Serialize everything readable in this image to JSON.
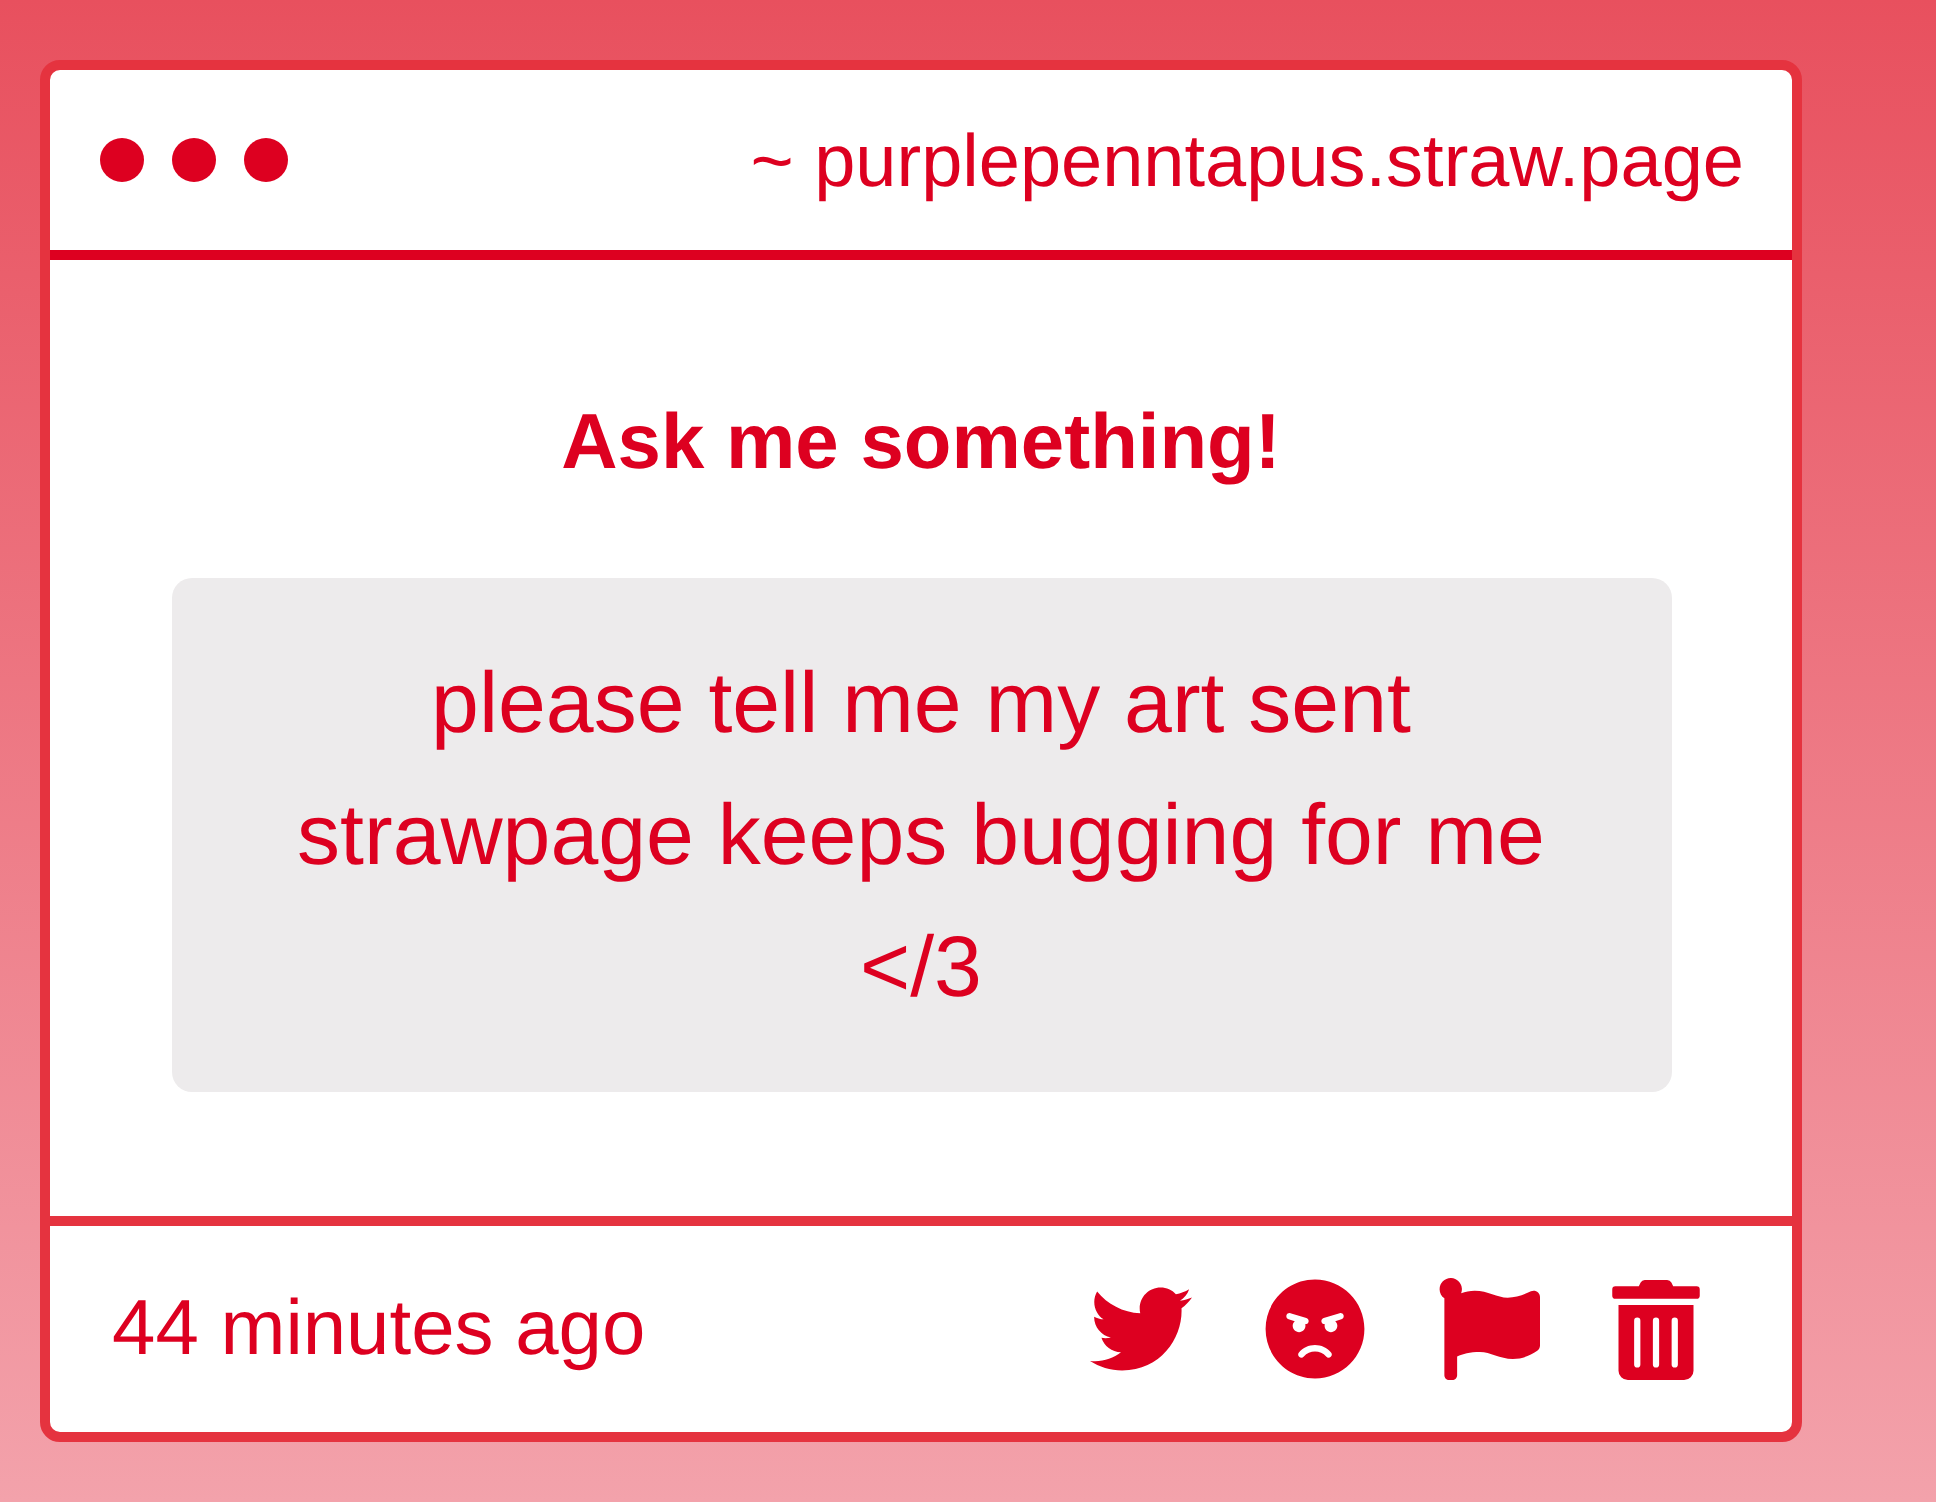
{
  "window": {
    "address": "~ purplepenntapus.straw.page"
  },
  "post": {
    "heading": "Ask me something!",
    "question": "please tell me my art sent strawpage keeps bugging for me </3"
  },
  "footer": {
    "time": "44 minutes ago"
  }
}
